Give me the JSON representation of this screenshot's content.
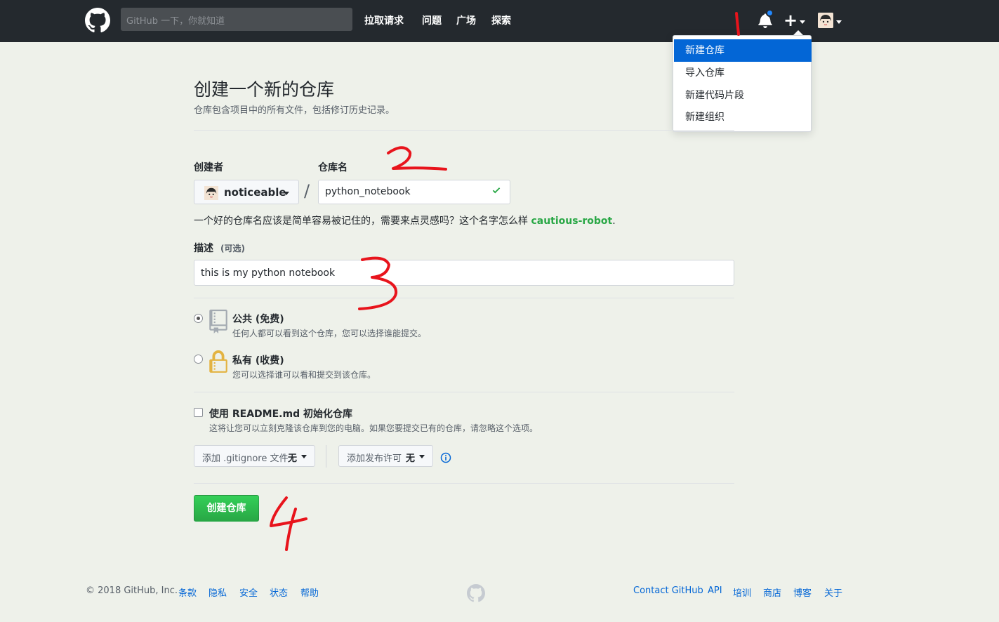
{
  "header": {
    "search_placeholder": "GitHub 一下，你就知道",
    "nav": [
      "拉取请求",
      "问题",
      "广场",
      "探索"
    ]
  },
  "dropdown": {
    "items": [
      "新建仓库",
      "导入仓库",
      "新建代码片段",
      "新建组织"
    ]
  },
  "page": {
    "title": "创建一个新的仓库",
    "subtitle": "仓库包含项目中的所有文件，包括修订历史记录。",
    "owner_label": "创建者",
    "repo_label": "仓库名",
    "owner_value": "noticeable",
    "repo_value": "python_notebook",
    "hint_text": "一个好的仓库名应该是简单容易被记住的，需要来点灵感吗？这个名字怎么样",
    "hint_suggestion": "cautious-robot",
    "hint_end": ".",
    "desc_label": "描述",
    "desc_optional": "(可选)",
    "desc_value": "this is my python notebook",
    "public_title": "公共 (免费)",
    "public_desc": "任何人都可以看到这个仓库，您可以选择谁能提交。",
    "private_title": "私有 (收费)",
    "private_desc": "您可以选择谁可以看和提交到该仓库。",
    "readme_title": "使用 README.md 初始化仓库",
    "readme_desc": "这将让您可以立刻克隆该仓库到您的电脑。如果您要提交已有的仓库，请忽略这个选项。",
    "gitignore_label": "添加 .gitignore 文件",
    "gitignore_value": "无",
    "license_label": "添加发布许可",
    "license_value": "无",
    "create_button": "创建仓库"
  },
  "footer": {
    "copyright": "© 2018 GitHub, Inc.",
    "left_links": [
      "条款",
      "隐私",
      "安全",
      "状态",
      "帮助"
    ],
    "right_links": [
      "Contact GitHub",
      "API",
      "培训",
      "商店",
      "博客",
      "关于"
    ]
  },
  "annotations": [
    "1",
    "2",
    "3",
    "4"
  ],
  "colors": {
    "header": "#24292e",
    "accent": "#0366d6",
    "success": "#28a745",
    "annotation": "#e8141c"
  }
}
